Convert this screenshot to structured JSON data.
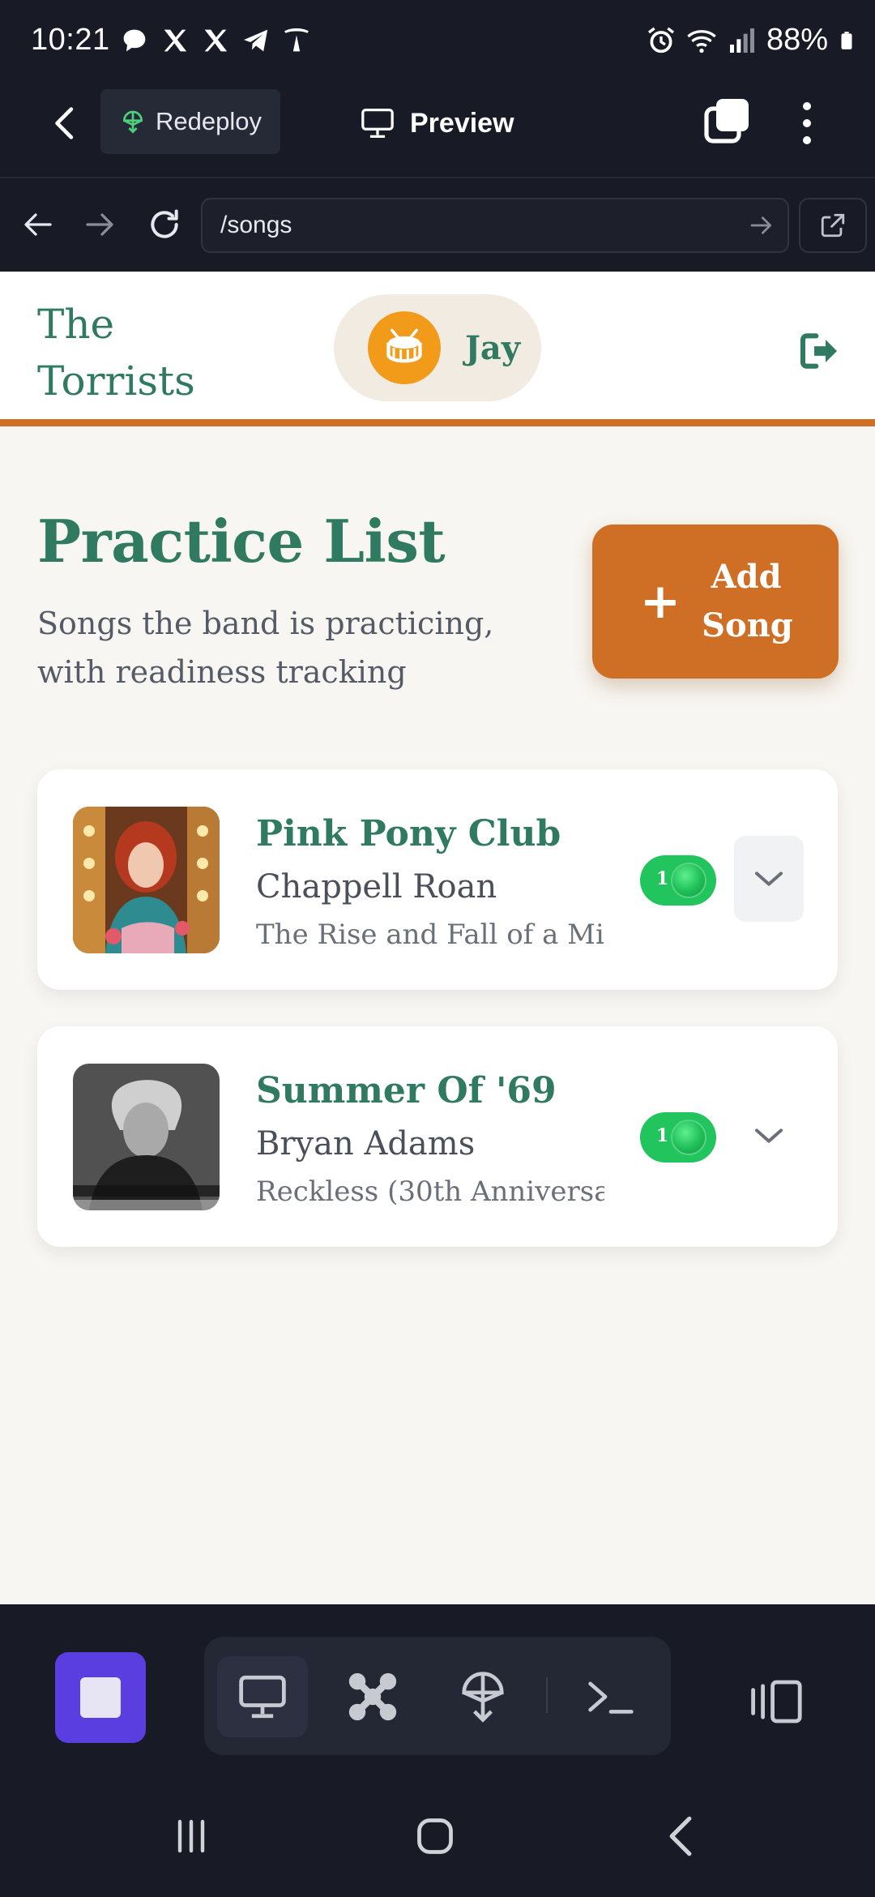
{
  "status_bar": {
    "time": "10:21",
    "battery": "88%",
    "left_icons": [
      "chat-bubble-icon",
      "x-logo-icon",
      "x-logo-icon",
      "telegram-icon",
      "tesla-icon"
    ],
    "right_icons": [
      "alarm-icon",
      "wifi-icon",
      "signal-icon",
      "battery-icon"
    ]
  },
  "app_toolbar": {
    "redeploy_label": "Redeploy",
    "preview_label": "Preview"
  },
  "url_bar": {
    "url": "/songs"
  },
  "site": {
    "brand": "The Torrists",
    "user_name": "Jay",
    "colors": {
      "primary": "#2f7a60",
      "accent": "#cf6f25",
      "avatar": "#f29b1a",
      "ready": "#22c45d"
    }
  },
  "page": {
    "title": "Practice List",
    "subtitle": "Songs the band is practicing, with readiness tracking",
    "add_button_label": "Add Song"
  },
  "songs": [
    {
      "title": "Pink Pony Club",
      "artist": "Chappell Roan",
      "album": "The Rise and Fall of a Mi...",
      "readiness": "1"
    },
    {
      "title": "Summer Of '69",
      "artist": "Bryan Adams",
      "album": "Reckless (30th Anniversa...",
      "readiness": "1"
    }
  ]
}
